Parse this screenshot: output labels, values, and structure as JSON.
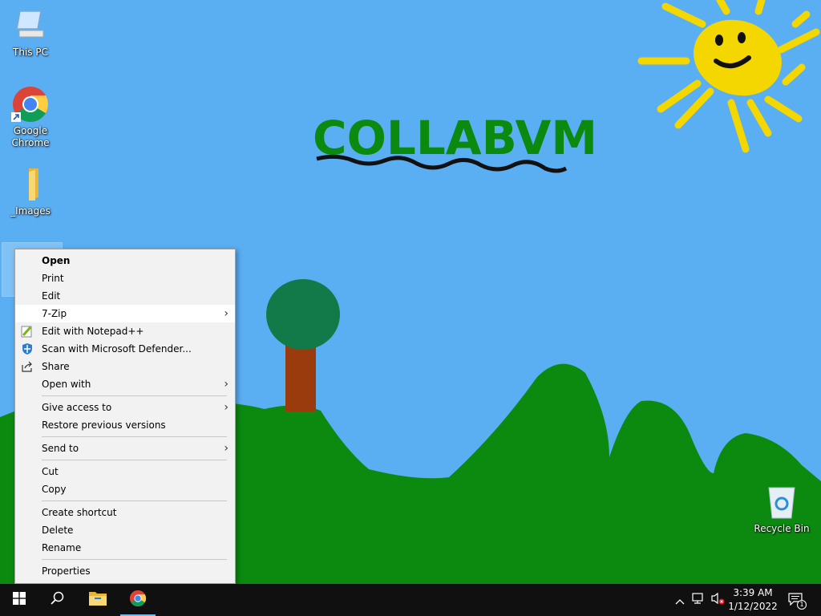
{
  "wallpaper": {
    "title_art": "COLLABVM"
  },
  "desktop_icons": {
    "this_pc": "This PC",
    "chrome": "Google Chrome",
    "images": "_Images",
    "recycle_bin": "Recycle Bin"
  },
  "context_menu": {
    "items": [
      {
        "label": "Open"
      },
      {
        "label": "Print"
      },
      {
        "label": "Edit"
      },
      {
        "label": "7-Zip"
      },
      {
        "label": "Edit with Notepad++"
      },
      {
        "label": "Scan with Microsoft Defender..."
      },
      {
        "label": "Share"
      },
      {
        "label": "Open with"
      },
      {
        "label": "Give access to"
      },
      {
        "label": "Restore previous versions"
      },
      {
        "label": "Send to"
      },
      {
        "label": "Cut"
      },
      {
        "label": "Copy"
      },
      {
        "label": "Create shortcut"
      },
      {
        "label": "Delete"
      },
      {
        "label": "Rename"
      },
      {
        "label": "Properties"
      }
    ]
  },
  "taskbar": {
    "clock_time": "3:39 AM",
    "clock_date": "1/12/2022",
    "notification_count": "1",
    "icons": [
      "windows-start-icon",
      "search-icon",
      "file-explorer-icon",
      "chrome-icon"
    ]
  },
  "colors": {
    "sky": "#5aaef2",
    "hills": "#0c8a10",
    "taskbar": "#101010",
    "menu_bg": "#f2f2f2"
  }
}
